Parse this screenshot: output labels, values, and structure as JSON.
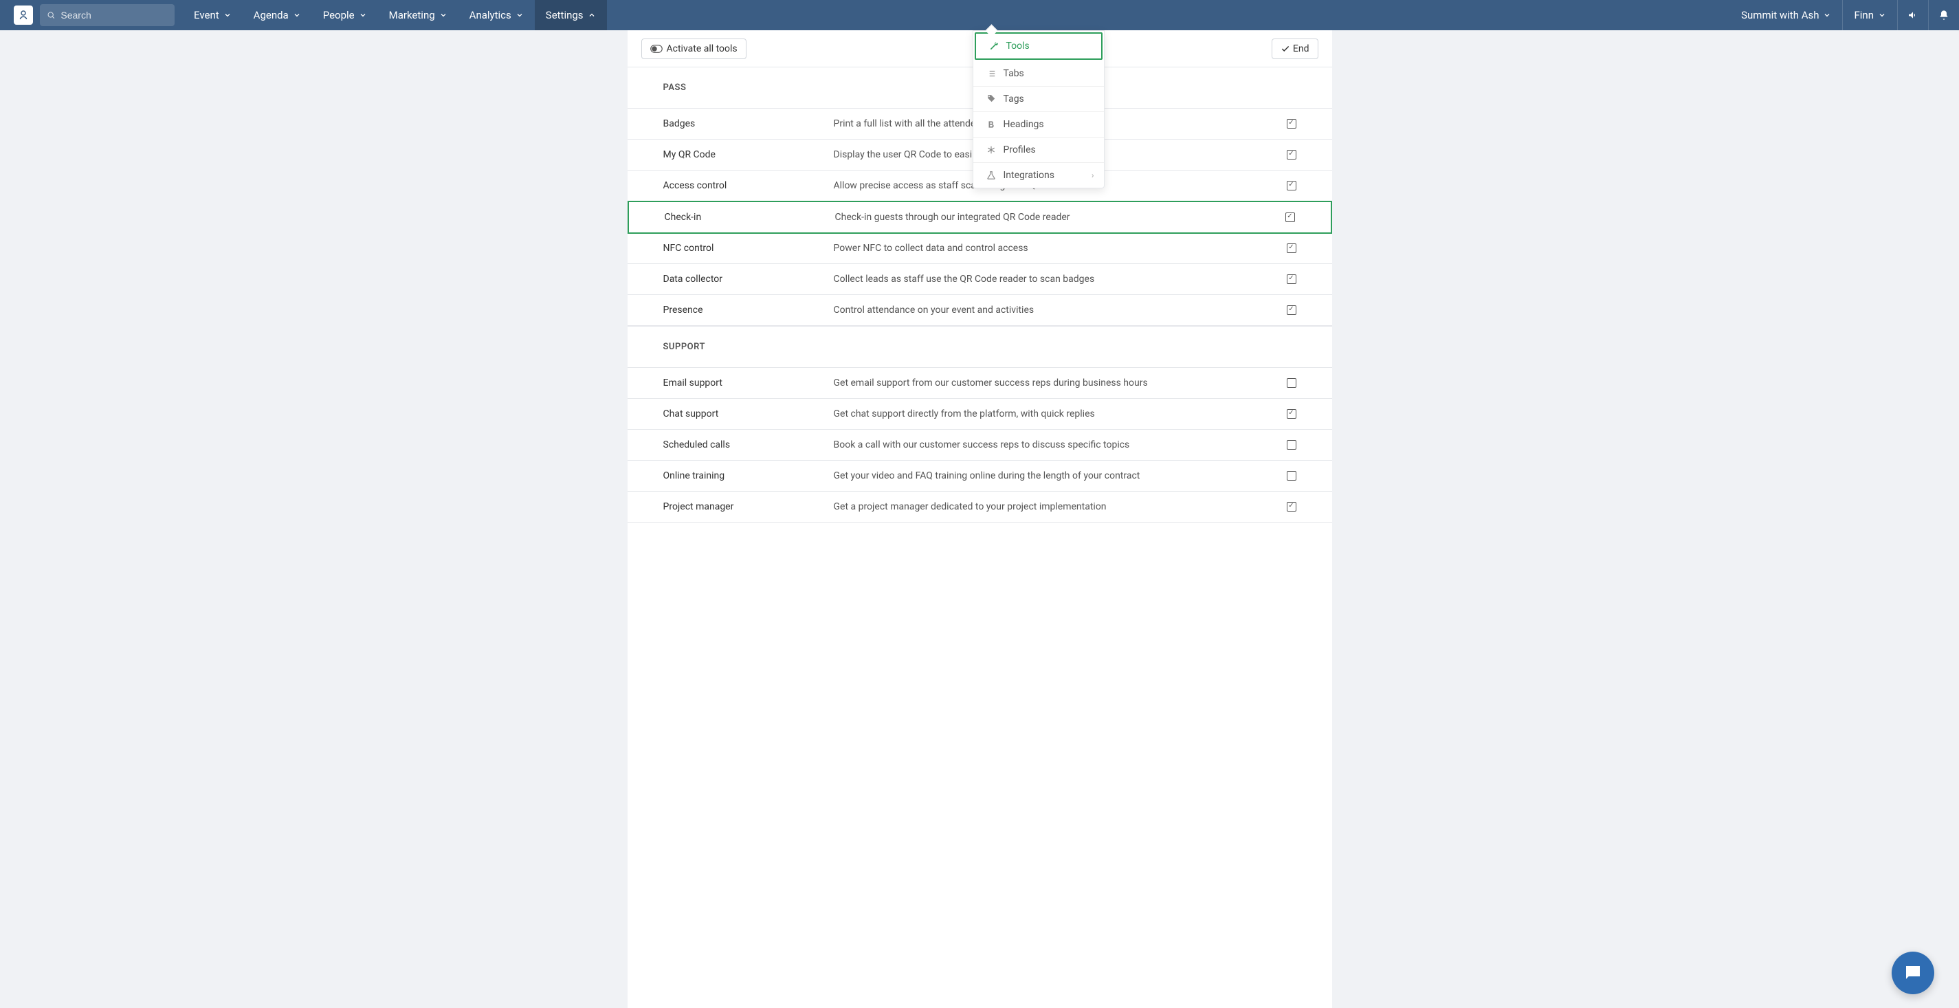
{
  "topbar": {
    "search_placeholder": "Search",
    "nav": [
      "Event",
      "Agenda",
      "People",
      "Marketing",
      "Analytics",
      "Settings"
    ],
    "active_nav": 5,
    "right_items": [
      "Summit with Ash",
      "Finn"
    ]
  },
  "toolbar": {
    "activate_label": "Activate all tools",
    "end_label": "End"
  },
  "dropdown": {
    "items": [
      {
        "icon": "wrench",
        "label": "Tools",
        "active": true
      },
      {
        "icon": "list",
        "label": "Tabs"
      },
      {
        "icon": "tag",
        "label": "Tags"
      },
      {
        "icon": "bold",
        "label": "Headings"
      },
      {
        "icon": "asterisk",
        "label": "Profiles"
      },
      {
        "icon": "flask",
        "label": "Integrations",
        "submenu": true
      }
    ]
  },
  "sections": [
    {
      "title": "PASS",
      "rows": [
        {
          "name": "Badges",
          "desc": "Print a full list with all the attendees",
          "checked": true
        },
        {
          "name": "My QR Code",
          "desc": "Display the user QR Code to easily s                                      ins",
          "checked": true
        },
        {
          "name": "Access control",
          "desc": "Allow precise access as staff scan badges or QR Codes",
          "checked": true
        },
        {
          "name": "Check-in",
          "desc": "Check-in guests through our integrated QR Code reader",
          "checked": true,
          "highlight": true
        },
        {
          "name": "NFC control",
          "desc": "Power NFC to collect data and control access",
          "checked": true
        },
        {
          "name": "Data collector",
          "desc": "Collect leads as staff use the QR Code reader to scan badges",
          "checked": true
        },
        {
          "name": "Presence",
          "desc": "Control attendance on your event and activities",
          "checked": true
        }
      ]
    },
    {
      "title": "SUPPORT",
      "rows": [
        {
          "name": "Email support",
          "desc": "Get email support from our customer success reps during business hours",
          "checked": false
        },
        {
          "name": "Chat support",
          "desc": "Get chat support directly from the platform, with quick replies",
          "checked": true
        },
        {
          "name": "Scheduled calls",
          "desc": "Book a call with our customer success reps to discuss specific topics",
          "checked": false
        },
        {
          "name": "Online training",
          "desc": "Get your video and FAQ training online during the length of your contract",
          "checked": false
        },
        {
          "name": "Project manager",
          "desc": "Get a project manager dedicated to your project implementation",
          "checked": true
        }
      ]
    }
  ]
}
